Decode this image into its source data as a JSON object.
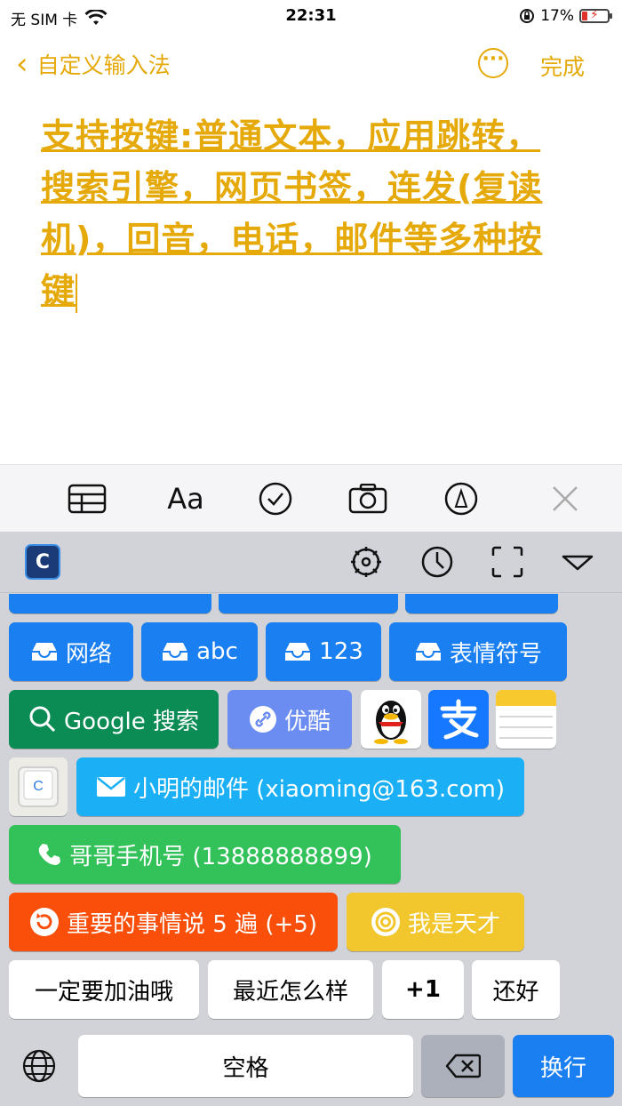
{
  "status_bar": {
    "carrier": "无 SIM 卡",
    "time": "22:31",
    "battery": "17%"
  },
  "nav": {
    "back_label": "自定义输入法",
    "more_icon": "ellipsis-icon",
    "done_label": "完成"
  },
  "note": {
    "text": "支持按键:普通文本，应用跳转，搜索引擎，网页书签，连发(复读机)，回音，电话，邮件等多种按键"
  },
  "format_toolbar": {
    "items": [
      "table-icon",
      "Aa",
      "checklist-icon",
      "camera-icon",
      "markup-icon",
      "close-icon"
    ],
    "text_format_label": "Aa"
  },
  "keyboard": {
    "app_logo": "C",
    "row_categories": {
      "network": "网络",
      "abc": "abc",
      "num": "123",
      "emoji": "表情符号"
    },
    "row_apps": {
      "google": "Google 搜索",
      "youku": "优酷"
    },
    "email_key": "小明的邮件 (xiaoming@163.com)",
    "phone_key": "哥哥手机号 (13888888899)",
    "repeat_key": "重要的事情说 5 遍 (+5)",
    "echo_key": "我是天才",
    "text_keys": [
      "一定要加油哦",
      "最近怎么样",
      "+1",
      "还好"
    ],
    "space_label": "空格",
    "return_label": "换行"
  },
  "colors": {
    "accent": "#e5a90a",
    "key_blue": "#1a7ff0",
    "keyboard_bg": "#d1d3d9"
  }
}
